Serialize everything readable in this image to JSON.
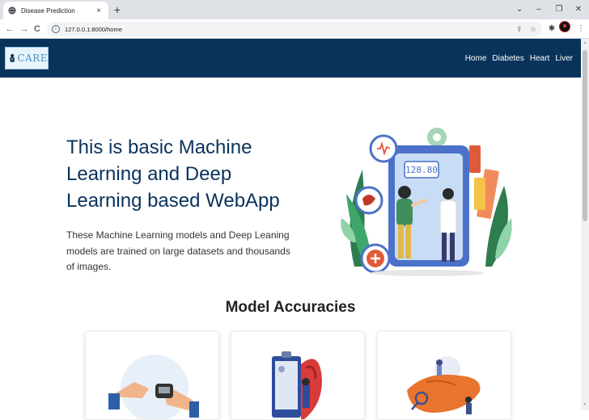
{
  "browser": {
    "tab_title": "Disease Prediction",
    "tab_close": "×",
    "new_tab": "+",
    "url": "127.0.0.1:8000/home",
    "window_controls": {
      "dropdown": "⌄",
      "minimize": "–",
      "restore": "❐",
      "close": "✕"
    },
    "nav": {
      "back": "←",
      "forward": "→",
      "reload": "C"
    },
    "omni_icons": {
      "share": "⇪",
      "bookmark": "☆"
    },
    "extensions": {
      "puzzle": "✱",
      "menu": "⋮"
    }
  },
  "site": {
    "logo_text": "CARE",
    "nav_items": [
      "Home",
      "Diabetes",
      "Heart",
      "Liver"
    ]
  },
  "hero": {
    "title": "This is basic Machine Learning and Deep Learning based WebApp",
    "description": "These Machine Learning models and Deep Leaning models are trained on large datasets and thousands of images.",
    "scale_reading": "128.80"
  },
  "accuracies": {
    "title": "Model Accuracies"
  },
  "colors": {
    "navbar": "#0a335c",
    "title": "#0a335c",
    "accent_red": "#e05a3a"
  }
}
